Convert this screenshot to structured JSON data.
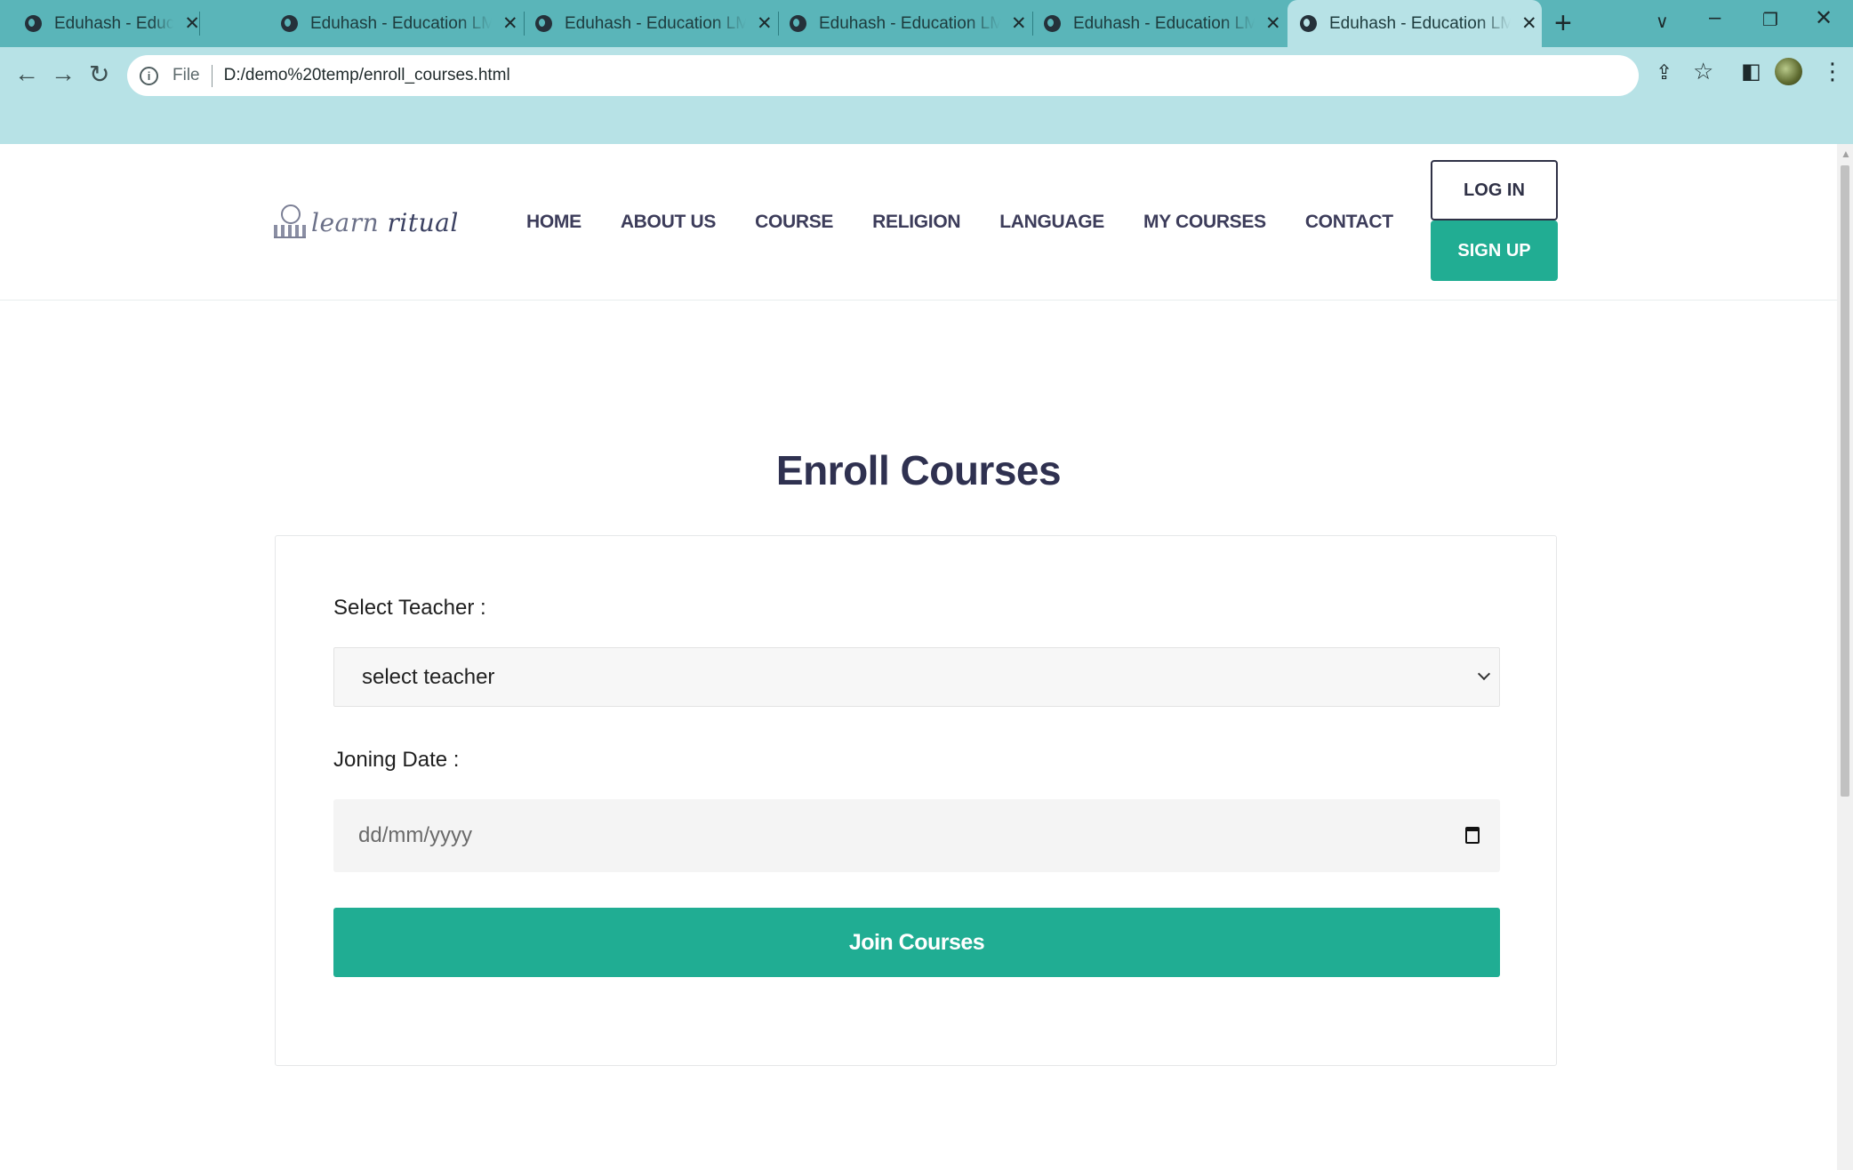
{
  "browser": {
    "tabs": [
      {
        "title": "Eduhash - Education LMS template",
        "active": false
      },
      {
        "title": "Eduhash - Education LMS template",
        "active": false
      },
      {
        "title": "Eduhash - Education LMS template",
        "active": false
      },
      {
        "title": "Eduhash - Education LMS template",
        "active": false
      },
      {
        "title": "Eduhash - Education LMS template",
        "active": false
      },
      {
        "title": "Eduhash - Education LMS template",
        "active": true
      }
    ],
    "address": {
      "scheme": "File",
      "url": "D:/demo%20temp/enroll_courses.html"
    }
  },
  "site": {
    "logo": {
      "word1": "learn",
      "word2": "ritual"
    },
    "nav": [
      "HOME",
      "ABOUT US",
      "COURSE",
      "RELIGION",
      "LANGUAGE",
      "MY COURSES",
      "CONTACT"
    ],
    "login_label": "LOG IN",
    "signup_label": "SIGN UP"
  },
  "page": {
    "title": "Enroll Courses",
    "form": {
      "teacher_label": "Select Teacher :",
      "teacher_selected": "select teacher",
      "date_label": "Joning Date :",
      "date_placeholder": "dd/mm/yyyy",
      "submit_label": "Join Courses"
    }
  },
  "colors": {
    "accent": "#21ad93",
    "heading": "#2f3150",
    "chrome": "#5ab5b9"
  }
}
